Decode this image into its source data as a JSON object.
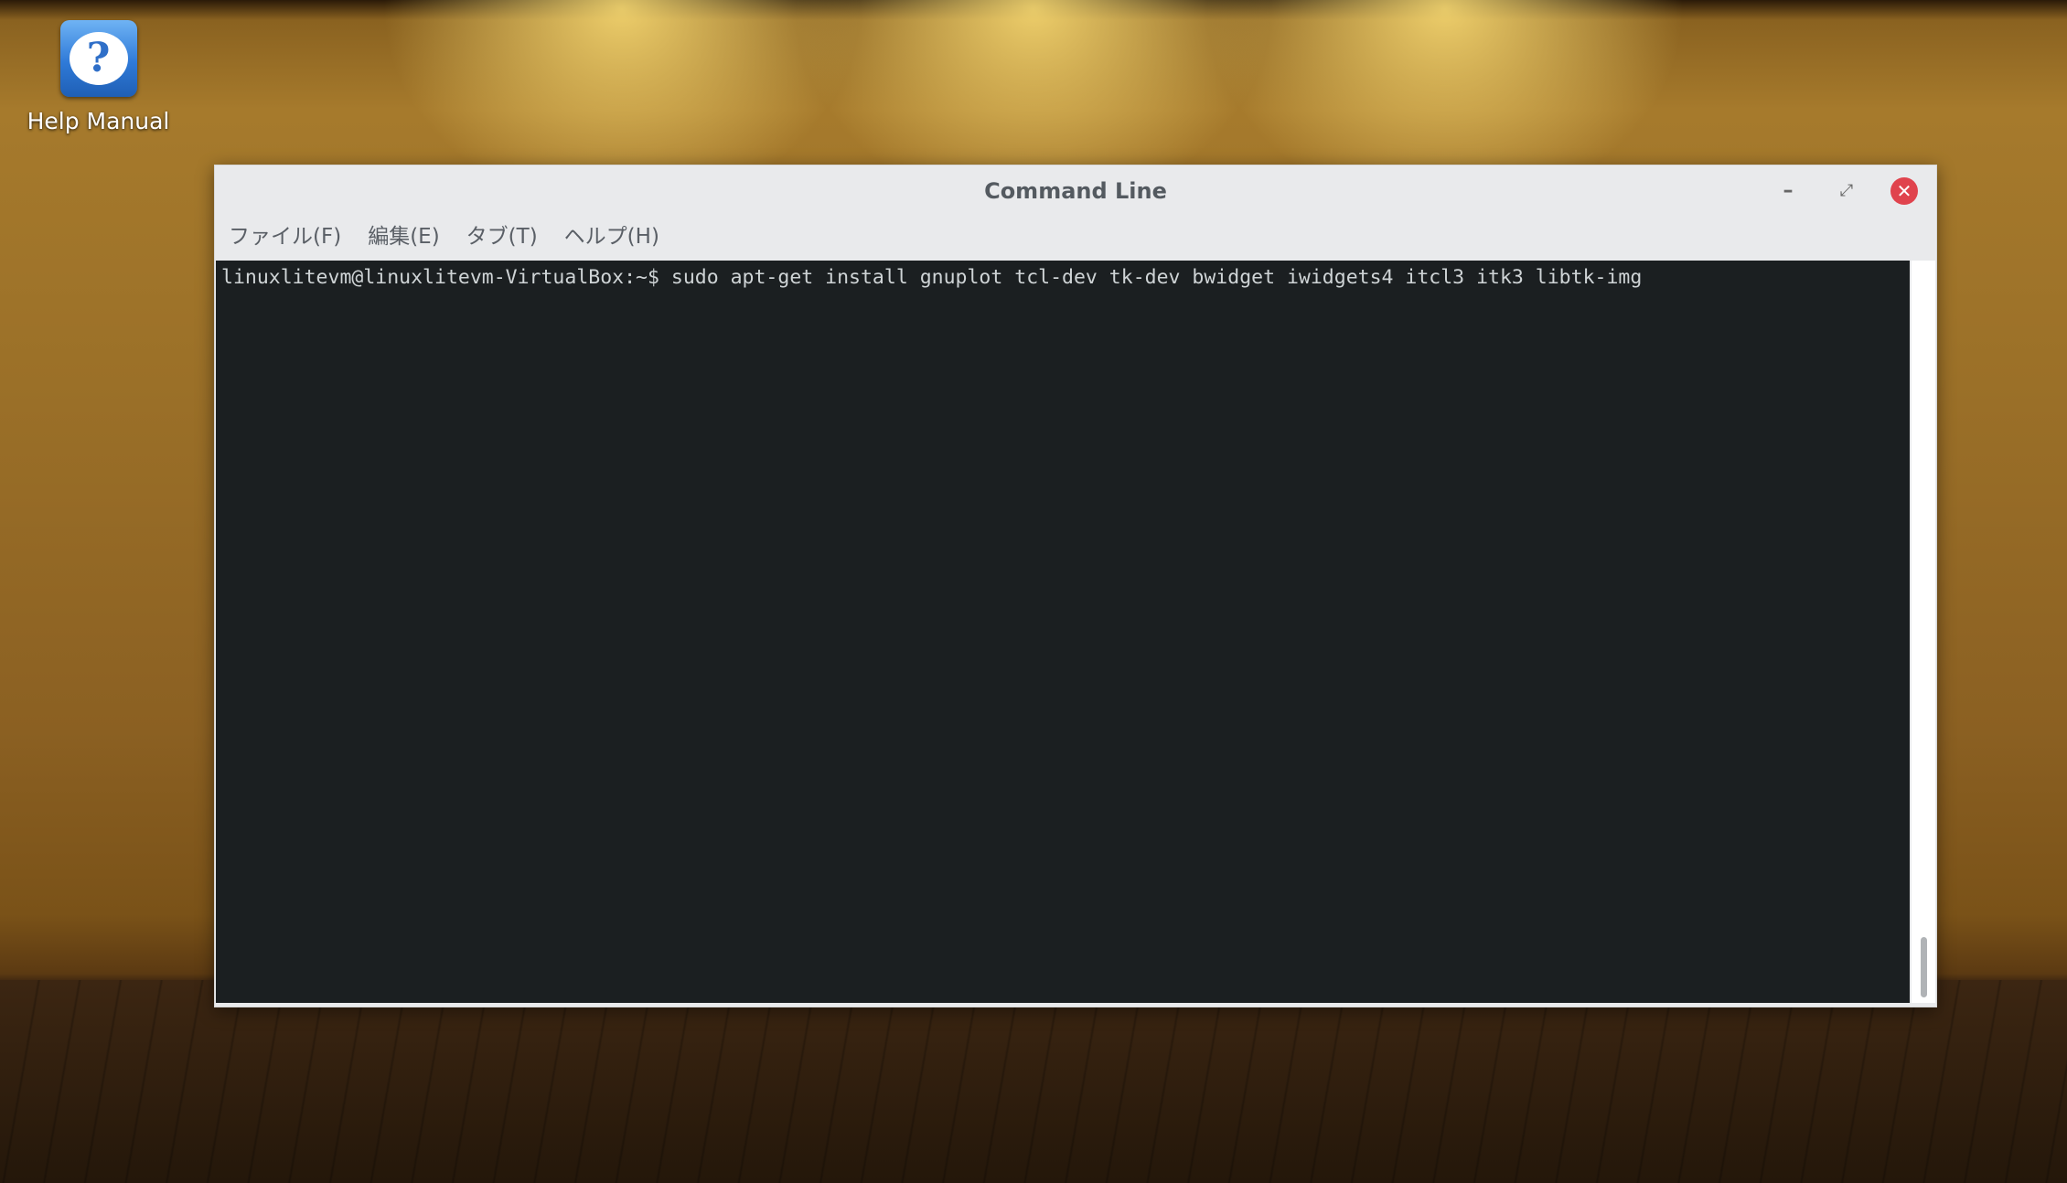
{
  "desktop": {
    "icons": [
      {
        "label": "Help Manual",
        "icon": "help-icon"
      }
    ]
  },
  "window": {
    "title": "Command Line",
    "controls": {
      "minimize": "–",
      "maximize": "⤢",
      "close": "✕"
    },
    "menu": [
      {
        "label": "ファイル(F)"
      },
      {
        "label": "編集(E)"
      },
      {
        "label": "タブ(T)"
      },
      {
        "label": "ヘルプ(H)"
      }
    ],
    "terminal": {
      "lines": [
        "linuxlitevm@linuxlitevm-VirtualBox:~$ sudo apt-get install gnuplot tcl-dev tk-dev bwidget iwidgets4 itcl3 itk3 libtk-img"
      ],
      "background": "#1b1f21",
      "foreground": "#cfd4d6"
    }
  },
  "colors": {
    "close_button": "#e0434d",
    "help_icon": "#2f7ad8"
  }
}
